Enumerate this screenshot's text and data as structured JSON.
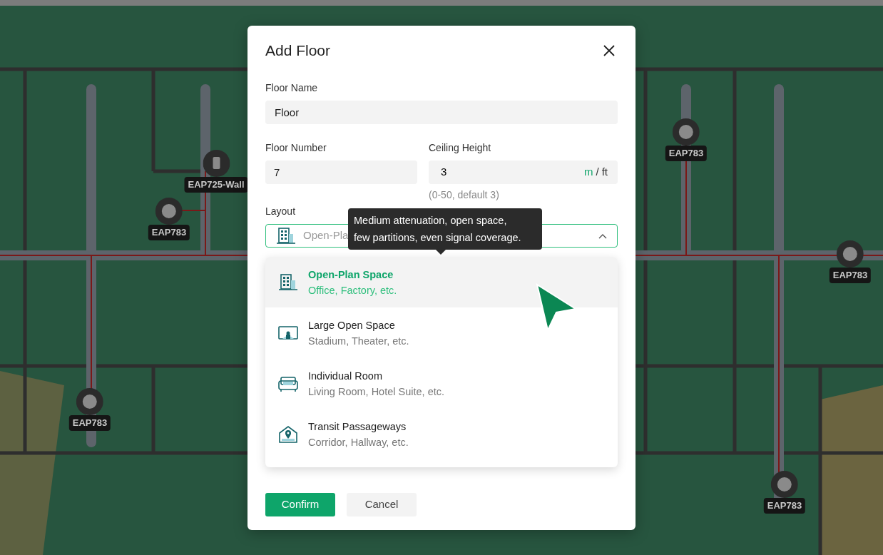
{
  "floor_plan": {
    "access_points": [
      {
        "label": "EAP725-Wall",
        "kind": "wall"
      },
      {
        "label": "EAP783",
        "kind": "ceiling"
      },
      {
        "label": "EAP783",
        "kind": "ceiling"
      },
      {
        "label": "EAP783",
        "kind": "ceiling"
      },
      {
        "label": "EAP783",
        "kind": "ceiling"
      },
      {
        "label": "EAP783",
        "kind": "ceiling"
      }
    ]
  },
  "dialog": {
    "title": "Add Floor",
    "floor_name": {
      "label": "Floor Name",
      "value": "Floor"
    },
    "floor_number": {
      "label": "Floor Number",
      "value": "7"
    },
    "ceiling_height": {
      "label": "Ceiling Height",
      "value": "3",
      "separator": "/",
      "units": [
        {
          "label": "m",
          "selected": true
        },
        {
          "label": "ft",
          "selected": false
        }
      ],
      "hint": "(0-50, default 3)"
    },
    "layout": {
      "label": "Layout",
      "value": {
        "kind": "building",
        "text": "Open-Pla"
      },
      "expanded": true,
      "tooltip_lines": [
        "Medium attenuation, open space,",
        "few partitions, even signal coverage."
      ],
      "options": [
        {
          "kind": "building",
          "title": "Open-Plan Space",
          "subtitle": "Office, Factory, etc.",
          "selected": true
        },
        {
          "kind": "theater",
          "title": "Large Open Space",
          "subtitle": "Stadium, Theater, etc.",
          "selected": false
        },
        {
          "kind": "sofa",
          "title": "Individual Room",
          "subtitle": "Living Room, Hotel Suite, etc.",
          "selected": false
        },
        {
          "kind": "location",
          "title": "Transit Passageways",
          "subtitle": "Corridor, Hallway, etc.",
          "selected": false
        }
      ]
    },
    "buttons": [
      {
        "kind": "primary",
        "label": "Confirm"
      },
      {
        "kind": "secondary",
        "label": "Cancel"
      }
    ]
  }
}
